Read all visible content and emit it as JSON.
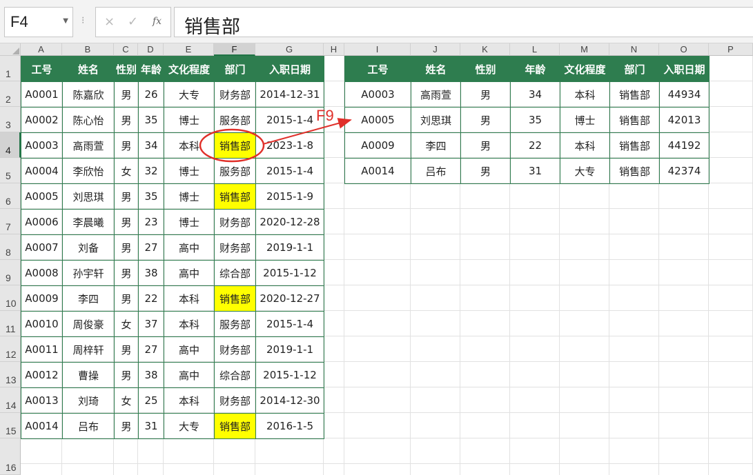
{
  "formula_bar": {
    "name_box": "F4",
    "fx_label": "fx",
    "cancel_icon": "×",
    "enter_icon": "✓",
    "formula": "销售部"
  },
  "columns": [
    "A",
    "B",
    "C",
    "D",
    "E",
    "F",
    "G",
    "H",
    "I",
    "J",
    "K",
    "L",
    "M",
    "N",
    "O",
    "P"
  ],
  "rows": [
    "1",
    "2",
    "3",
    "4",
    "5",
    "6",
    "7",
    "8",
    "9",
    "10",
    "11",
    "12",
    "13",
    "14",
    "15",
    "16"
  ],
  "active_cell": {
    "col": "F",
    "row": "4"
  },
  "source_table": {
    "headers": [
      "工号",
      "姓名",
      "性别",
      "年龄",
      "文化程度",
      "部门",
      "入职日期"
    ],
    "rows": [
      [
        "A0001",
        "陈嘉欣",
        "男",
        "26",
        "大专",
        "财务部",
        "2014-12-31"
      ],
      [
        "A0002",
        "陈心怡",
        "男",
        "35",
        "博士",
        "服务部",
        "2015-1-4"
      ],
      [
        "A0003",
        "高雨萱",
        "男",
        "34",
        "本科",
        "销售部",
        "2023-1-8"
      ],
      [
        "A0004",
        "李欣怡",
        "女",
        "32",
        "博士",
        "服务部",
        "2015-1-4"
      ],
      [
        "A0005",
        "刘思琪",
        "男",
        "35",
        "博士",
        "销售部",
        "2015-1-9"
      ],
      [
        "A0006",
        "李晨曦",
        "男",
        "23",
        "博士",
        "财务部",
        "2020-12-28"
      ],
      [
        "A0007",
        "刘备",
        "男",
        "27",
        "高中",
        "财务部",
        "2019-1-1"
      ],
      [
        "A0008",
        "孙宇轩",
        "男",
        "38",
        "高中",
        "综合部",
        "2015-1-12"
      ],
      [
        "A0009",
        "李四",
        "男",
        "22",
        "本科",
        "销售部",
        "2020-12-27"
      ],
      [
        "A0010",
        "周俊豪",
        "女",
        "37",
        "本科",
        "服务部",
        "2015-1-4"
      ],
      [
        "A0011",
        "周梓轩",
        "男",
        "27",
        "高中",
        "财务部",
        "2019-1-1"
      ],
      [
        "A0012",
        "曹操",
        "男",
        "38",
        "高中",
        "综合部",
        "2015-1-12"
      ],
      [
        "A0013",
        "刘琦",
        "女",
        "25",
        "本科",
        "财务部",
        "2014-12-30"
      ],
      [
        "A0014",
        "吕布",
        "男",
        "31",
        "大专",
        "销售部",
        "2016-1-5"
      ]
    ],
    "highlight_value": "销售部"
  },
  "result_table": {
    "headers": [
      "工号",
      "姓名",
      "性别",
      "年龄",
      "文化程度",
      "部门",
      "入职日期"
    ],
    "rows": [
      [
        "A0003",
        "高雨萱",
        "男",
        "34",
        "本科",
        "销售部",
        "44934"
      ],
      [
        "A0005",
        "刘思琪",
        "男",
        "35",
        "博士",
        "销售部",
        "42013"
      ],
      [
        "A0009",
        "李四",
        "男",
        "22",
        "本科",
        "销售部",
        "44192"
      ],
      [
        "A0014",
        "吕布",
        "男",
        "31",
        "大专",
        "销售部",
        "42374"
      ]
    ]
  },
  "annotation": {
    "label": "F9",
    "color": "#e0302a"
  },
  "colors": {
    "header_green": "#2e7d4f",
    "highlight_yellow": "#ffff00",
    "selection_green": "#217346"
  }
}
